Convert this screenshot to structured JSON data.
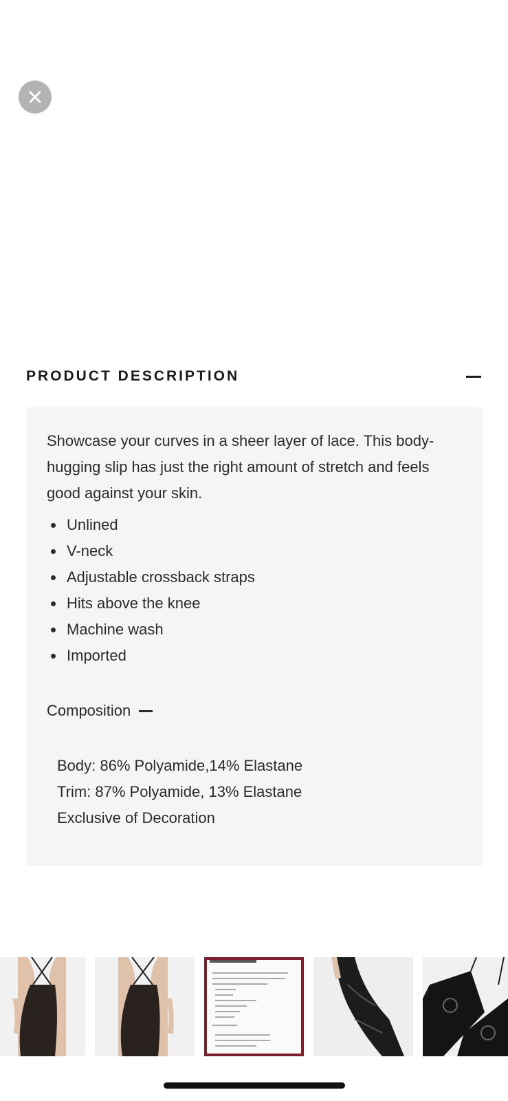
{
  "header": {
    "close_icon": "close-icon"
  },
  "product_description": {
    "title": "PRODUCT DESCRIPTION",
    "collapse_icon": "minus-icon",
    "text": "Showcase your curves in a sheer layer of lace. This body-hugging slip has just the right amount of stretch and feels good against your skin.",
    "features": [
      "Unlined",
      "V-neck",
      "Adjustable crossback straps",
      "Hits above the knee",
      "Machine wash",
      "Imported"
    ],
    "composition": {
      "label": "Composition",
      "lines": [
        "Body: 86% Polyamide,14% Elastane",
        "Trim: 87% Polyamide, 13% Elastane",
        "Exclusive of Decoration"
      ]
    }
  },
  "thumbnails": {
    "selected_index": 2,
    "selected_border_color": "#7a1f2b",
    "items": [
      {
        "type": "photo",
        "alt": "back view lace slip"
      },
      {
        "type": "photo",
        "alt": "back view lace slip"
      },
      {
        "type": "text-preview",
        "title": "PRODUCT DESCRIPTION"
      },
      {
        "type": "photo",
        "alt": "side view lace slip"
      },
      {
        "type": "photo",
        "alt": "lace detail"
      }
    ]
  }
}
